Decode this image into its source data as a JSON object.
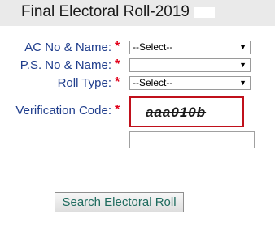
{
  "title": "Final Electoral Roll-2019",
  "form": {
    "ac_label": "AC No & Name:",
    "ps_label": "P.S. No & Name:",
    "roll_type_label": "Roll Type:",
    "verification_label": "Verification Code:",
    "required_marker": "*",
    "ac_select_value": "--Select--",
    "ps_select_value": "",
    "roll_type_select_value": "--Select--",
    "captcha_text": "aaa010b",
    "verification_input_value": "",
    "submit_label": "Search Electoral Roll"
  },
  "icons": {
    "dropdown": "dropdown-arrow-icon"
  },
  "colors": {
    "label": "#1f3d8c",
    "required": "#e1001a",
    "captcha_border": "#c0101b",
    "button_text": "#1e6b5e",
    "header_bg": "#eaeaea"
  }
}
